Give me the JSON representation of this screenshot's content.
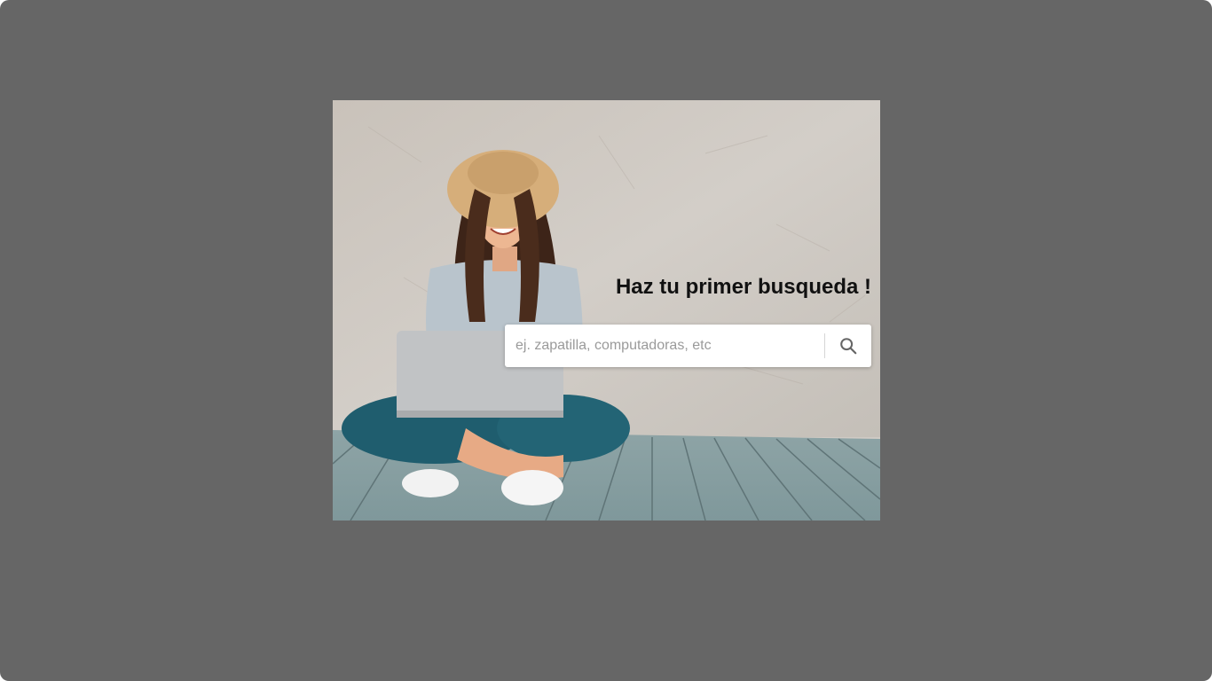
{
  "hero": {
    "image_alt": "woman-with-laptop-photo",
    "headline": "Haz tu primer busqueda !"
  },
  "search": {
    "value": "",
    "placeholder": "ej. zapatilla, computadoras, etc",
    "icon": "search-icon"
  },
  "colors": {
    "overlay": "#666666",
    "headline": "#111111",
    "placeholder": "#9a9a9a"
  }
}
